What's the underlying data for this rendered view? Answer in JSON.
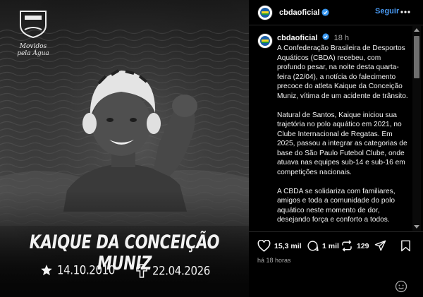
{
  "image": {
    "brand": {
      "name": "CBDA",
      "tagline": "Movidos pela Água"
    },
    "athlete_name": "KAIQUE DA CONCEIÇÃO MUNIZ",
    "birth": {
      "icon": "star-icon",
      "date": "14.10.2010"
    },
    "death": {
      "icon": "cross-icon",
      "date": "22.04.2026"
    }
  },
  "post": {
    "header": {
      "username": "cbdaoficial",
      "follow_label": "Seguir",
      "more_icon": "ellipsis-icon"
    },
    "caption": {
      "username": "cbdaoficial",
      "time": "18 h",
      "paragraphs": [
        "A Confederação Brasileira de Desportos Aquáticos (CBDA) recebeu, com profundo pesar, na noite desta quarta-feira (22/04), a notícia do falecimento precoce do atleta Kaique da Conceição Muniz, vítima de um acidente de trânsito.",
        "Natural de Santos, Kaique iniciou sua trajetória no polo aquático em 2021, no Clube Internacional de Regatas. Em 2025, passou a integrar as categorias de base do São Paulo Futebol Clube, onde atuava nas equipes sub-14 e sub-16 em competições nacionais.",
        "A CBDA se solidariza com familiares, amigos e toda a comunidade do polo aquático neste momento de dor, desejando força e conforto a todos."
      ]
    },
    "actions": {
      "likes": "15,3 mil",
      "comments": "1 mil",
      "reposts": "129"
    },
    "posted_ago": "há 18 horas"
  },
  "colors": {
    "accent_link": "#4a9cf6",
    "verified": "#3897f0",
    "background": "#000000"
  }
}
